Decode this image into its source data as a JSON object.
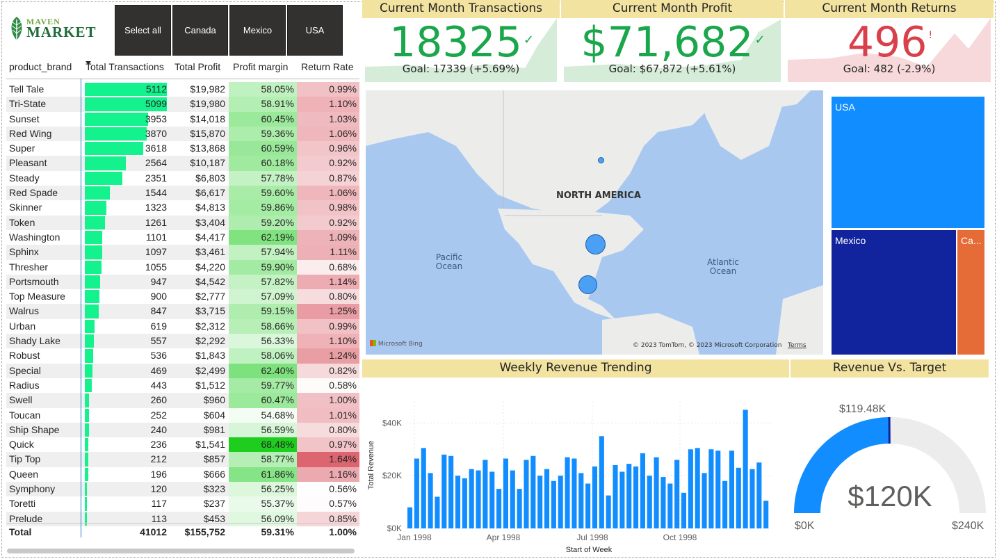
{
  "brand": {
    "name_top": "MAVEN",
    "name_bottom": "MARKET"
  },
  "slicer": {
    "buttons": [
      "Select all",
      "Canada",
      "Mexico",
      "USA"
    ]
  },
  "table": {
    "headers": [
      "product_brand",
      "Total Transactions",
      "Total Profit",
      "Profit margin",
      "Return Rate"
    ],
    "rows": [
      [
        "Tell Tale",
        "5112",
        "$19,982",
        "58.05%",
        "0.99%"
      ],
      [
        "Tri-State",
        "5099",
        "$19,980",
        "58.91%",
        "1.10%"
      ],
      [
        "Sunset",
        "3953",
        "$14,018",
        "60.45%",
        "1.03%"
      ],
      [
        "Red Wing",
        "3870",
        "$15,870",
        "59.36%",
        "1.06%"
      ],
      [
        "Super",
        "3618",
        "$13,868",
        "60.59%",
        "0.96%"
      ],
      [
        "Pleasant",
        "2564",
        "$10,187",
        "60.18%",
        "0.92%"
      ],
      [
        "Steady",
        "2351",
        "$6,803",
        "57.78%",
        "0.87%"
      ],
      [
        "Red Spade",
        "1544",
        "$6,617",
        "59.60%",
        "1.06%"
      ],
      [
        "Skinner",
        "1323",
        "$4,813",
        "59.86%",
        "0.98%"
      ],
      [
        "Token",
        "1261",
        "$3,404",
        "59.20%",
        "0.92%"
      ],
      [
        "Washington",
        "1101",
        "$4,417",
        "62.19%",
        "1.09%"
      ],
      [
        "Sphinx",
        "1097",
        "$3,461",
        "57.94%",
        "1.11%"
      ],
      [
        "Thresher",
        "1055",
        "$4,220",
        "59.90%",
        "0.68%"
      ],
      [
        "Portsmouth",
        "947",
        "$4,542",
        "57.82%",
        "1.14%"
      ],
      [
        "Top Measure",
        "900",
        "$2,777",
        "57.09%",
        "0.80%"
      ],
      [
        "Walrus",
        "847",
        "$3,715",
        "59.15%",
        "1.25%"
      ],
      [
        "Urban",
        "619",
        "$2,312",
        "58.66%",
        "0.99%"
      ],
      [
        "Shady Lake",
        "557",
        "$2,292",
        "56.33%",
        "1.10%"
      ],
      [
        "Robust",
        "536",
        "$1,843",
        "58.06%",
        "1.24%"
      ],
      [
        "Special",
        "469",
        "$2,499",
        "62.40%",
        "0.82%"
      ],
      [
        "Radius",
        "443",
        "$1,512",
        "59.77%",
        "0.58%"
      ],
      [
        "Swell",
        "260",
        "$960",
        "60.47%",
        "1.00%"
      ],
      [
        "Toucan",
        "252",
        "$604",
        "54.68%",
        "1.01%"
      ],
      [
        "Ship Shape",
        "240",
        "$981",
        "56.59%",
        "0.80%"
      ],
      [
        "Quick",
        "236",
        "$1,541",
        "68.48%",
        "0.97%"
      ],
      [
        "Tip Top",
        "212",
        "$857",
        "58.77%",
        "1.64%"
      ],
      [
        "Queen",
        "196",
        "$666",
        "61.86%",
        "1.16%"
      ],
      [
        "Symphony",
        "120",
        "$323",
        "56.25%",
        "0.56%"
      ],
      [
        "Toretti",
        "117",
        "$237",
        "55.37%",
        "0.57%"
      ],
      [
        "Prelude",
        "113",
        "$453",
        "56.09%",
        "0.85%"
      ]
    ],
    "total": [
      "Total",
      "41012",
      "$155,752",
      "59.31%",
      "1.00%"
    ]
  },
  "kpis": [
    {
      "title": "Current Month Transactions",
      "value": "18325",
      "mark": "✓",
      "goal": "Goal: 17339 (+5.69%)",
      "color": "#1aa64a",
      "spark": "#d5ecd9"
    },
    {
      "title": "Current Month Profit",
      "value": "$71,682",
      "mark": "✓",
      "goal": "Goal: $67,872 (+5.61%)",
      "color": "#1aa64a",
      "spark": "#d5ecd9"
    },
    {
      "title": "Current Month Returns",
      "value": "496",
      "mark": "!",
      "goal": "Goal: 482 (-2.9%)",
      "color": "#d9404c",
      "spark": "#f7d9dc"
    }
  ],
  "map": {
    "region_label": "NORTH AMERICA",
    "pacific_label": "Pacific Ocean",
    "atlantic_label": "Atlantic Ocean",
    "bing_label": "Microsoft Bing",
    "credit": "© 2023 TomTom, © 2023 Microsoft Corporation",
    "terms": "Terms"
  },
  "treemap": {
    "items": [
      {
        "label": "USA",
        "color": "#118dff"
      },
      {
        "label": "Mexico",
        "color": "#12239e"
      },
      {
        "label": "Ca...",
        "color": "#e66c37"
      }
    ]
  },
  "sections": {
    "weekly": "Weekly Revenue Trending",
    "target": "Revenue Vs. Target"
  },
  "chart_data": [
    {
      "type": "bar",
      "title": "Weekly Revenue Trending",
      "xlabel": "Start of Week",
      "ylabel": "Total Revenue",
      "x_tick_labels": [
        "Jan 1998",
        "Apr 1998",
        "Jul 1998",
        "Oct 1998"
      ],
      "y_tick_labels": [
        "$0K",
        "$20K",
        "$40K"
      ],
      "ylim": [
        0,
        48000
      ],
      "color": "#118dff",
      "values": [
        8000,
        26500,
        30500,
        21000,
        12000,
        28000,
        27500,
        20000,
        19000,
        22500,
        22000,
        26000,
        21500,
        15000,
        26500,
        22000,
        15000,
        26000,
        27500,
        20000,
        22500,
        18000,
        20000,
        27000,
        26500,
        21000,
        17000,
        23500,
        35000,
        12500,
        24000,
        21500,
        24500,
        23500,
        28500,
        20000,
        27000,
        19500,
        17000,
        26000,
        13500,
        30000,
        30500,
        21000,
        30000,
        29500,
        18000,
        29500,
        23000,
        45000,
        22500,
        25000,
        10500
      ]
    },
    {
      "type": "gauge",
      "title": "Revenue Vs. Target",
      "value": 119480,
      "value_label": "$120K",
      "target": 119480,
      "target_label": "$119.48K",
      "min": 0,
      "max": 240000,
      "min_label": "$0K",
      "max_label": "$240K",
      "fill_color": "#118dff",
      "track_color": "#ececec",
      "target_color": "#12239e"
    }
  ]
}
